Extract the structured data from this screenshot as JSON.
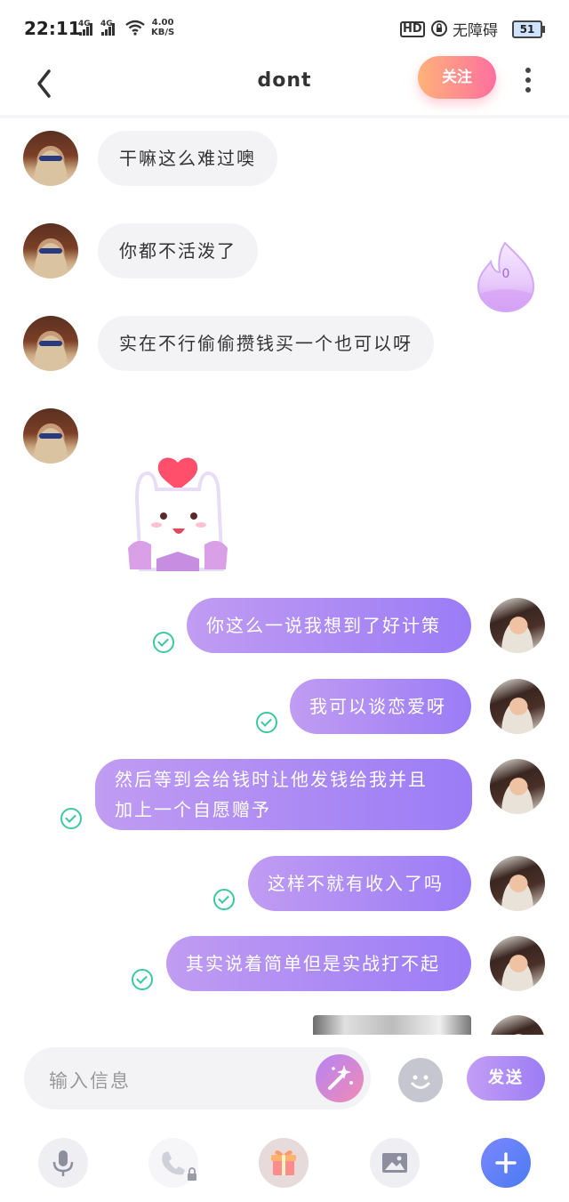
{
  "status_bar": {
    "time": "22:11",
    "network_1": "4G",
    "network_2": "4G",
    "speed_value": "4.00",
    "speed_unit": "KB/S",
    "hd_label": "HD",
    "accessibility": "无障碍",
    "battery": "51"
  },
  "header": {
    "title": "dont",
    "follow_label": "关注"
  },
  "fire_counter": "0",
  "messages_received": [
    {
      "text": "干嘛这么难过噢"
    },
    {
      "text": "你都不活泼了"
    },
    {
      "text": "实在不行偷偷攒钱买一个也可以呀"
    }
  ],
  "messages_sent": [
    {
      "lines": [
        "你这么一说我想到了好计策"
      ]
    },
    {
      "lines": [
        "我可以谈恋爱呀"
      ]
    },
    {
      "lines": [
        "然后等到会给钱时让他发钱给我并且",
        "加上一个自愿赠予"
      ]
    },
    {
      "lines": [
        "这样不就有收入了吗"
      ]
    },
    {
      "lines": [
        "其实说着简单但是实战打不起"
      ]
    }
  ],
  "input": {
    "placeholder": "输入信息",
    "send_label": "发送"
  },
  "colors": {
    "sent_bubble_start": "#c09cf2",
    "sent_bubble_end": "#9b7cf6",
    "received_bubble": "#f3f3f6",
    "read_check": "#3cc99a",
    "follow_start": "#ffb27a",
    "follow_end": "#ff6f9e"
  }
}
